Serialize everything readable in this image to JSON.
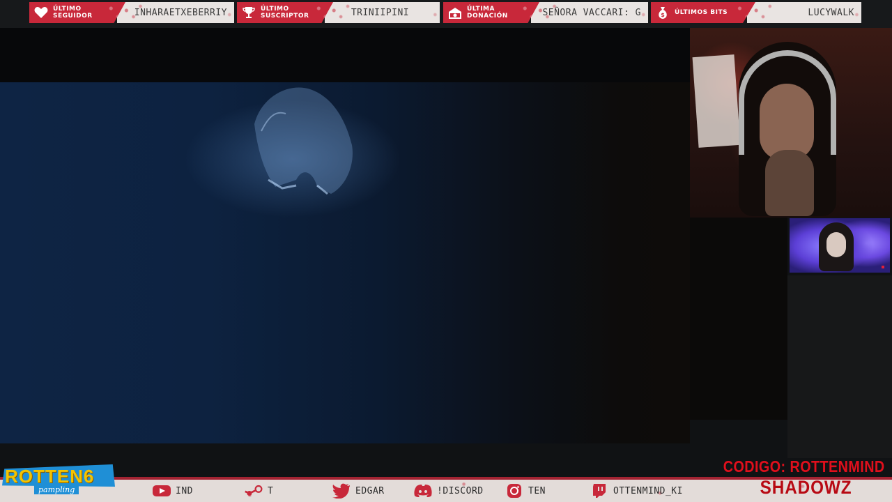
{
  "top_alerts": [
    {
      "icon": "heart-icon",
      "label": "ÚLTIMO\nSEGUIDOR",
      "value": "INHARAETXEBERRIY"
    },
    {
      "icon": "trophy-icon",
      "label": "ÚLTIMO\nSUSCRIPTOR",
      "value": "TRINIIPINI"
    },
    {
      "icon": "donation-icon",
      "label": "ÚLTIMA\nDONACIÓN",
      "value": "SEÑORA VACCARI: G"
    },
    {
      "icon": "money-bag-icon",
      "label": "ÚLTIMOS BITS",
      "value": "LUCYWALK"
    }
  ],
  "social_links": [
    {
      "icon": "youtube-icon",
      "text": "IND"
    },
    {
      "icon": "steam-icon",
      "text": "T"
    },
    {
      "icon": "twitter-icon",
      "text": "EDGAR"
    },
    {
      "icon": "discord-icon",
      "text": "!DISCORD"
    },
    {
      "icon": "instagram-icon",
      "text": "TEN"
    },
    {
      "icon": "twitch-icon",
      "text": "OTTENMIND_KI"
    }
  ],
  "logo": {
    "word": "ROTTEN6",
    "sub": "pampling"
  },
  "promo": {
    "line1": "CODIGO: ROTTENMIND",
    "line2": "SHADOWZ"
  },
  "colors": {
    "accent": "#c8283a",
    "bar_light": "#e3dcd9",
    "promo_red": "#e00f1c",
    "logo_blue": "#1f8fd6",
    "logo_yellow": "#f4c300"
  }
}
